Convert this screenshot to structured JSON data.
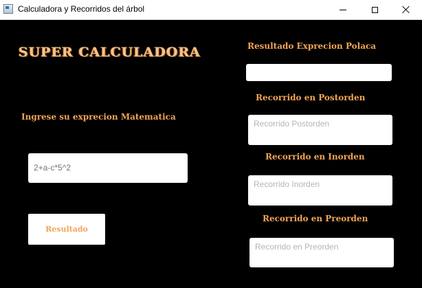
{
  "window": {
    "title": "Calculadora y Recorridos del árbol",
    "icon": "app-window-icon"
  },
  "main": {
    "title": "SUPER CALCULADORA",
    "expression_label": "Ingrese su exprecion Matematica",
    "expression_input": {
      "value": "",
      "placeholder": "2+a-c*5^2"
    },
    "result_button": "Resultado"
  },
  "results": {
    "polaca_label": "Resultado Exprecion Polaca",
    "polaca_value": "",
    "postorden_label": "Recorrido en Postorden",
    "postorden_placeholder": "Recorrido Postorden",
    "inorden_label": "Recorrido en Inorden",
    "inorden_placeholder": "Recorrido Inorden",
    "preorden_label": "Recorrido en Preorden",
    "preorden_placeholder": "Recorrido en Preorden"
  },
  "colors": {
    "accent": "#f3a456",
    "background": "#000000",
    "field": "#ffffff"
  }
}
